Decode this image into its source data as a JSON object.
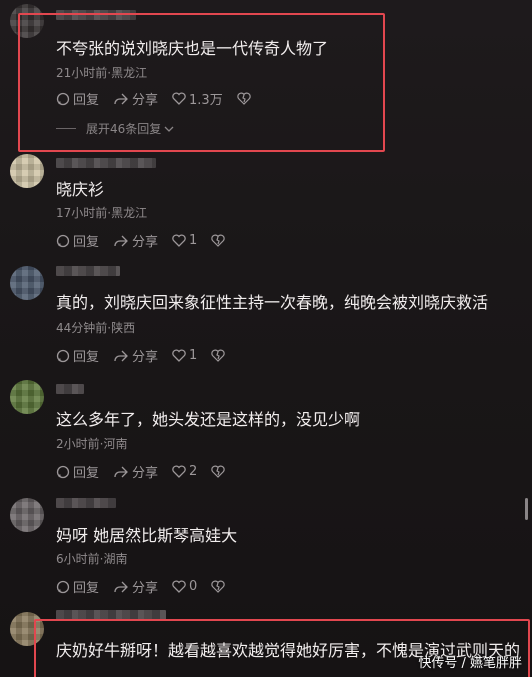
{
  "comments": [
    {
      "text": "不夸张的说刘晓庆也是一代传奇人物了",
      "meta": "21小时前·黑龙江",
      "reply": "回复",
      "share": "分享",
      "likes": "1.3万",
      "expand": "展开46条回复"
    },
    {
      "text": "晓庆衫",
      "meta": "17小时前·黑龙江",
      "reply": "回复",
      "share": "分享",
      "likes": "1"
    },
    {
      "text": "真的，刘晓庆回来象征性主持一次春晚，纯晚会被刘晓庆救活",
      "meta": "44分钟前·陕西",
      "reply": "回复",
      "share": "分享",
      "likes": "1"
    },
    {
      "text": "这么多年了，她头发还是这样的，没见少啊",
      "meta": "2小时前·河南",
      "reply": "回复",
      "share": "分享",
      "likes": "2"
    },
    {
      "text": "妈呀 她居然比斯琴高娃大",
      "meta": "6小时前·湖南",
      "reply": "回复",
      "share": "分享",
      "likes": "0"
    },
    {
      "text": "庆奶好牛掰呀！越看越喜欢越觉得她好厉害，不愧是演过武则天的"
    }
  ],
  "watermark": "快传号 / 嬿笔胖胖",
  "colors": {
    "highlight": "#e2474f",
    "background": "#1a1718"
  },
  "icons": [
    "comment-icon",
    "share-icon",
    "heart-icon",
    "broken-heart-icon",
    "chevron-down-icon"
  ]
}
